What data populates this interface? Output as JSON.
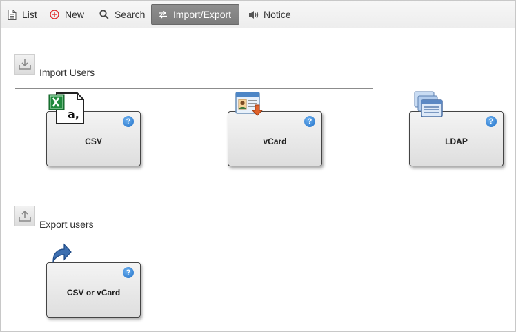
{
  "toolbar": {
    "list_label": "List",
    "new_label": "New",
    "search_label": "Search",
    "import_export_label": "Import/Export",
    "notice_label": "Notice",
    "active_tab": "Import/Export"
  },
  "import_section": {
    "title": "Import Users",
    "cards": [
      {
        "label": "CSV",
        "icon": "excel-csv-icon"
      },
      {
        "label": "vCard",
        "icon": "vcard-icon"
      },
      {
        "label": "LDAP",
        "icon": "ldap-icon"
      }
    ]
  },
  "export_section": {
    "title": "Export users",
    "cards": [
      {
        "label": "CSV or vCard",
        "icon": "export-arrow-icon"
      }
    ]
  },
  "help_glyph": "?",
  "colors": {
    "help_blue": "#1f6fc7",
    "active_tab_bg": "#858585",
    "new_icon_red": "#e03030"
  }
}
